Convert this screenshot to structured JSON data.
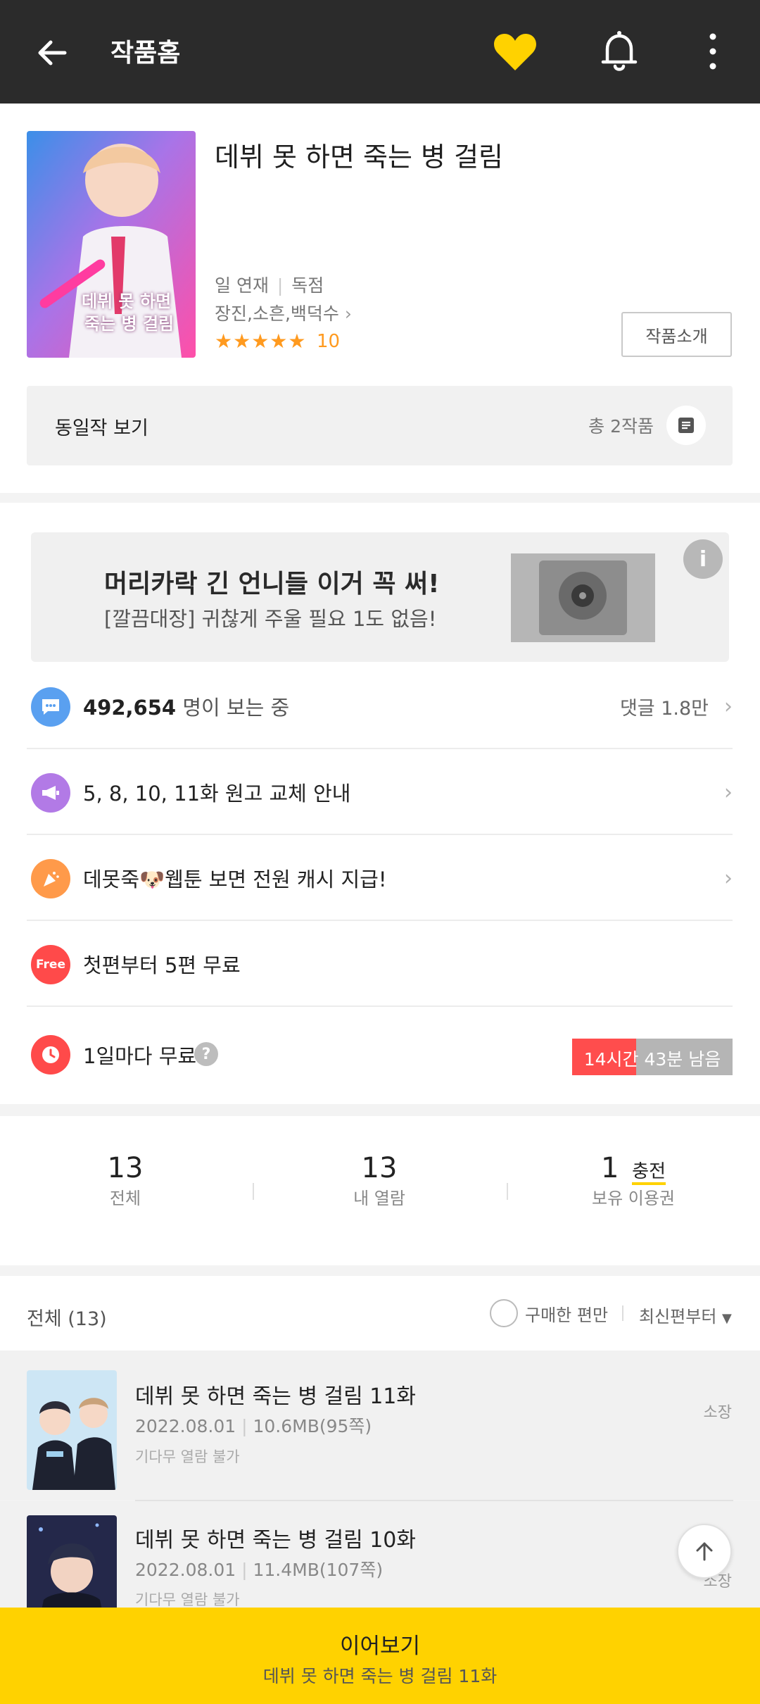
{
  "topbar": {
    "title": "작품홈"
  },
  "work": {
    "title": "데뷔 못 하면 죽는 병 걸림",
    "schedule": "일 연재",
    "exclusive": "독점",
    "authors": "장진,소흔,백덕수",
    "stars": "★★★★★",
    "rating": "10",
    "intro_button": "작품소개",
    "cover_text_line1": "데뷔 못 하면",
    "cover_text_line2": "죽는 병 걸림"
  },
  "same_work": {
    "label": "동일작 보기",
    "count": "총 2작품"
  },
  "ad": {
    "headline": "머리카락 긴 언니들 이거 꼭 써!",
    "sub": "[깔끔대장] 귀찮게 주울 필요 1도 없음!"
  },
  "viewers": {
    "count": "492,654",
    "suffix": "명이 보는 중",
    "comments": "댓글 1.8만"
  },
  "rows": {
    "notice": "5, 8, 10, 11화 원고 교체 안내",
    "event": "데못죽🐶웹툰 보면 전원 캐시 지급!",
    "free_badge": "Free",
    "free_text": "첫편부터 5편 무료",
    "daily_text": "1일마다 무료",
    "daily_help": "?",
    "remaining": "14시간 43분 남음",
    "remaining_progress": 0.4
  },
  "stats": {
    "total_num": "13",
    "total_label": "전체",
    "read_num": "13",
    "read_label": "내 열람",
    "ticket_num": "1",
    "ticket_charge": "충전",
    "ticket_label": "보유 이용권"
  },
  "list": {
    "header": "전체 (13)",
    "purchased_only": "구매한 편만",
    "sort": "최신편부터",
    "episodes": [
      {
        "title": "데뷔 못 하면 죽는 병 걸림 11화",
        "date": "2022.08.01",
        "size": "10.6MB(95쪽)",
        "note": "기다무 열람 불가",
        "owned": "소장"
      },
      {
        "title": "데뷔 못 하면 죽는 병 걸림 10화",
        "date": "2022.08.01",
        "size": "11.4MB(107쪽)",
        "note": "기다무 열람 불가",
        "owned": "소장"
      }
    ]
  },
  "bottom": {
    "action": "이어보기",
    "episode": "데뷔 못 하면 죽는 병 걸림 11화"
  }
}
